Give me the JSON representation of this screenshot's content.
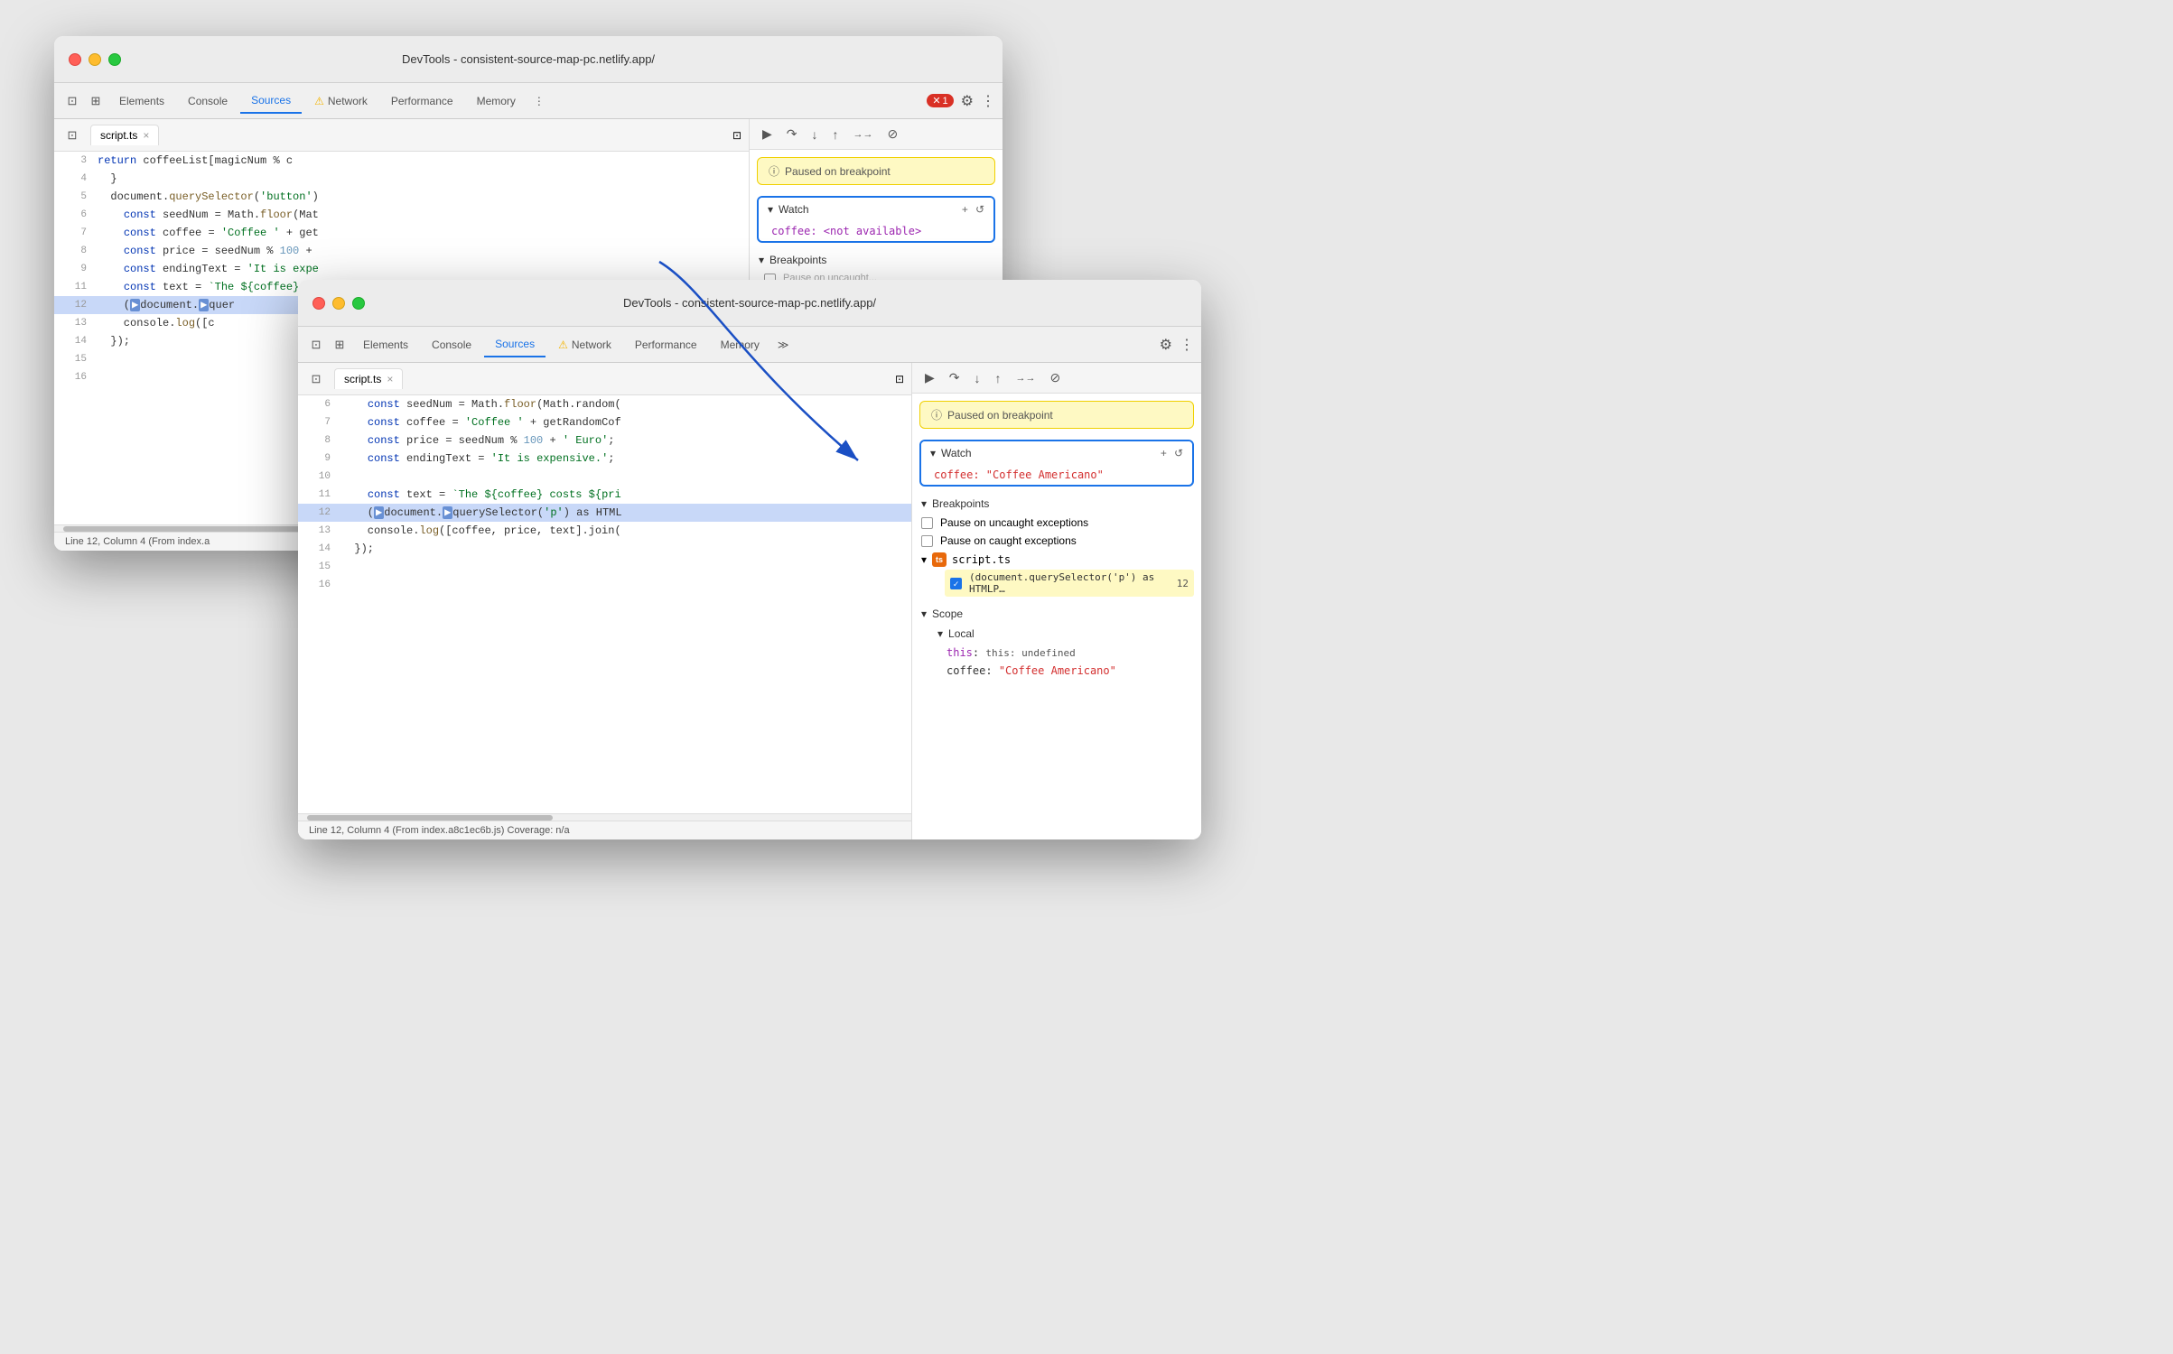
{
  "window1": {
    "title": "DevTools - consistent-source-map-pc.netlify.app/",
    "tabs": [
      "Elements",
      "Console",
      "Sources",
      "Network",
      "Performance",
      "Memory"
    ],
    "active_tab": "Sources",
    "file_tab": "script.ts",
    "toolbar_paused": "Paused on breakpoint",
    "watch_label": "Watch",
    "watch_expression": "coffee: <not available>",
    "breakpoints_label": "Breakpoints",
    "code_lines": [
      {
        "num": "3",
        "code": "    return coffeeList[magicNum % c"
      },
      {
        "num": "4",
        "code": "  }"
      },
      {
        "num": "5",
        "code": "  document.querySelector('button')"
      },
      {
        "num": "6",
        "code": "    const seedNum = Math.floor(Mat"
      },
      {
        "num": "7",
        "code": "    const coffee = 'Coffee ' + get"
      },
      {
        "num": "8",
        "code": "    const price = seedNum % 100 +"
      },
      {
        "num": "9",
        "code": "    const endingText = 'It is expe"
      },
      {
        "num": "11",
        "code": "    const text = `The ${coffee} co"
      },
      {
        "num": "12",
        "code": "    (document.querySelector"
      },
      {
        "num": "13",
        "code": "    console.log([c"
      },
      {
        "num": "14",
        "code": "  });"
      },
      {
        "num": "15",
        "code": ""
      },
      {
        "num": "16",
        "code": ""
      }
    ],
    "status_bar": "Line 12, Column 4  (From index.a",
    "error_count": "1"
  },
  "window2": {
    "title": "DevTools - consistent-source-map-pc.netlify.app/",
    "tabs": [
      "Elements",
      "Console",
      "Sources",
      "Network",
      "Performance",
      "Memory"
    ],
    "active_tab": "Sources",
    "file_tab": "script.ts",
    "toolbar_paused": "Paused on breakpoint",
    "watch_label": "Watch",
    "watch_expression": "coffee: \"Coffee Americano\"",
    "breakpoints_label": "Breakpoints",
    "code_lines": [
      {
        "num": "6",
        "code": "    const seedNum = Math.floor(Math.random("
      },
      {
        "num": "7",
        "code": "    const coffee = 'Coffee ' + getRandomCof"
      },
      {
        "num": "8",
        "code": "    const price = seedNum % 100 + ' Euro';"
      },
      {
        "num": "9",
        "code": "    const endingText = 'It is expensive.';"
      },
      {
        "num": "10",
        "code": ""
      },
      {
        "num": "11",
        "code": "    const text = `The ${coffee} costs ${pri"
      },
      {
        "num": "12",
        "code": "    (document.querySelector('p') as HTML"
      },
      {
        "num": "13",
        "code": "    console.log([coffee, price, text].join("
      },
      {
        "num": "14",
        "code": "  });"
      },
      {
        "num": "15",
        "code": ""
      },
      {
        "num": "16",
        "code": ""
      }
    ],
    "bp_expression": "(document.querySelector('p') as HTMLP…",
    "bp_line": "12",
    "scope_label": "Scope",
    "local_label": "Local",
    "local_this": "this: undefined",
    "local_coffee": "coffee: \"Coffee Americano\"",
    "status_bar": "Line 12, Column 4  (From index.a8c1ec6b.js)  Coverage: n/a",
    "pause_uncaught": "Pause on uncaught exceptions",
    "pause_caught": "Pause on caught exceptions"
  },
  "icons": {
    "chevron_right": "▶",
    "chevron_down": "▾",
    "plus": "+",
    "refresh": "↺",
    "info": "ⓘ",
    "resume": "▶",
    "step_over": "↷",
    "step_into": "↓",
    "step_out": "↑",
    "continue": "→→",
    "deactivate": "⊘",
    "settings": "⚙",
    "more": "⋮",
    "close": "×",
    "expand_sidebar": "⊡",
    "file_navigator": "⊞"
  }
}
